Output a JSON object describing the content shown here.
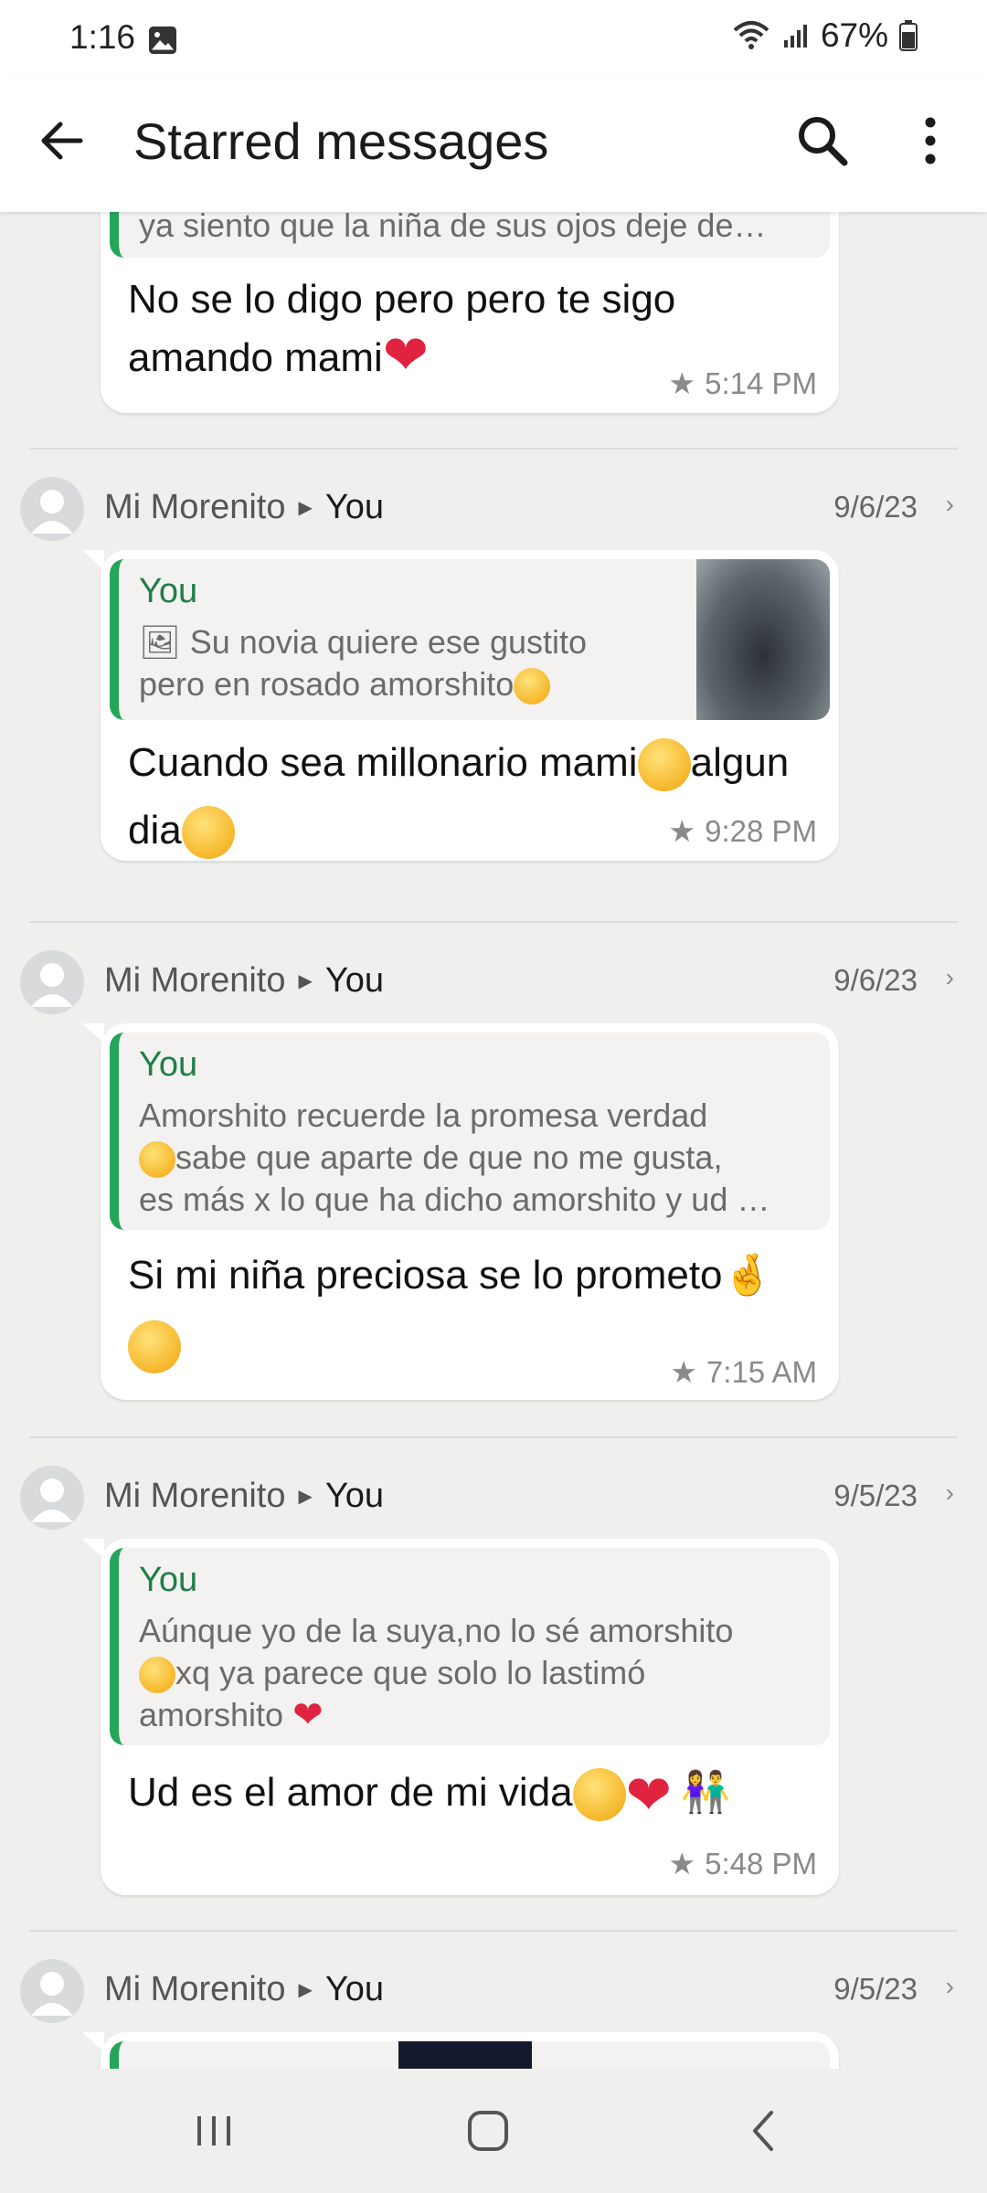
{
  "status": {
    "time": "1:16",
    "battery": "67%"
  },
  "appbar": {
    "title": "Starred messages"
  },
  "items": [
    {
      "quote_text": "ya siento que la niña de sus ojos deje de…",
      "message_line1": "No se lo digo pero pero te sigo",
      "message_line2": "amando mami",
      "time": "5:14 PM"
    },
    {
      "sender": "Mi Morenito",
      "to": "You",
      "date": "9/6/23",
      "quote_name": "You",
      "quote_line1": "Su novia quiere ese gustito",
      "quote_line2": "pero en rosado amorshito",
      "message_line1": "Cuando sea millonario mami",
      "message_line1b": "algun",
      "message_line2": "dia",
      "time": "9:28 PM"
    },
    {
      "sender": "Mi Morenito",
      "to": "You",
      "date": "9/6/23",
      "quote_name": "You",
      "quote_line1": "Amorshito recuerde la promesa verdad",
      "quote_line2": "sabe que aparte de que no me gusta,",
      "quote_line3": "es más x lo que ha dicho amorshito y ud …",
      "message_line1": "Si mi niña preciosa se lo prometo",
      "time": "7:15 AM"
    },
    {
      "sender": "Mi Morenito",
      "to": "You",
      "date": "9/5/23",
      "quote_name": "You",
      "quote_line1": "Aúnque yo de la suya,no lo sé amorshito",
      "quote_line2": "xq ya parece que solo lo lastimó",
      "quote_line3": "amorshito",
      "message_line1": "Ud es el amor de mi vida",
      "time": "5:48 PM"
    },
    {
      "sender": "Mi Morenito",
      "to": "You",
      "date": "9/5/23"
    }
  ]
}
